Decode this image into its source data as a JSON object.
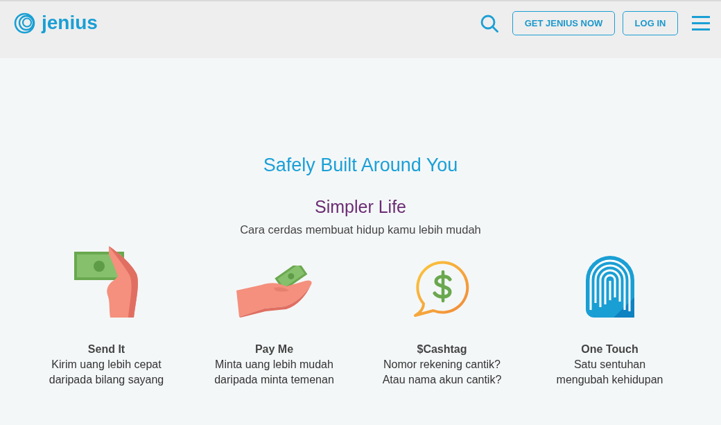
{
  "header": {
    "brand": "jenius",
    "buttons": [
      "GET JENIUS NOW",
      "LOG IN"
    ]
  },
  "section": {
    "title": "Safely Built Around You",
    "subtitle": "Simpler Life",
    "tagline": "Cara cerdas membuat hidup kamu lebih mudah"
  },
  "features": [
    {
      "title": "Send It",
      "description": "Kirim uang lebih cepat\ndaripada bilang sayang"
    },
    {
      "title": "Pay Me",
      "description": "Minta uang lebih mudah\ndaripada minta temenan"
    },
    {
      "title": "$Cashtag",
      "description": "Nomor rekening cantik?\nAtau nama akun cantik?"
    },
    {
      "title": "One Touch",
      "description": "Satu sentuhan\nmengubah kehidupan"
    }
  ]
}
